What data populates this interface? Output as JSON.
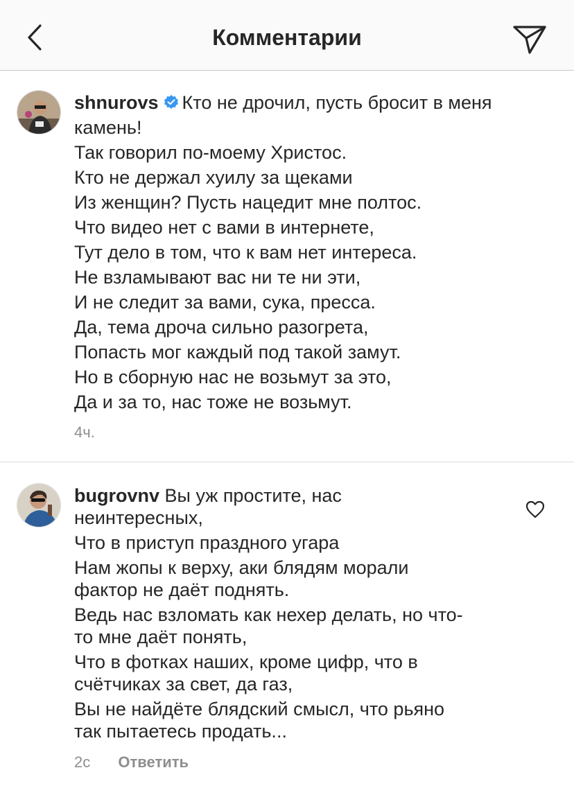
{
  "header": {
    "title": "Комментарии",
    "back_icon": "chevron-left-icon",
    "send_icon": "paper-plane-icon"
  },
  "comments": [
    {
      "username": "shnurovs",
      "verified": true,
      "first_line": "Кто не дрочил, пусть бросит в меня",
      "lines": [
        "камень!",
        "Так говорил по-моему Христос.",
        "Кто не держал хуилу за щеками",
        "Из женщин? Пусть нацедит мне полтос.",
        "Что видео нет с вами в интернете,",
        "Тут дело в том, что к вам нет интереса.",
        "Не взламывают вас ни те ни эти,",
        "И не следит за вами, сука, пресса.",
        "Да, тема дроча сильно разогрета,",
        "Попасть мог каждый под такой замут.",
        "Но в сборную нас не возьмут за это,",
        "Да и за то, нас тоже не возьмут."
      ],
      "time": "4ч."
    },
    {
      "username": "bugrovnv",
      "verified": false,
      "first_line": "Вы уж простите, нас",
      "lines": [
        "неинтересных,",
        "Что в приступ праздного угара",
        "Нам жопы к верху, аки блядям морали",
        "фактор не даёт поднять.",
        "Ведь нас взломать как нехер делать, но что-",
        "то мне даёт понять,",
        "Что в фотках наших, кроме цифр, что в",
        "счётчиках за свет, да газ,",
        "Вы не найдёте блядский смысл, что рьяно",
        "так пытаетесь продать..."
      ],
      "time": "2с",
      "reply_label": "Ответить"
    }
  ],
  "colors": {
    "text": "#262626",
    "secondary": "#8e8e8e",
    "verified": "#3897f0",
    "divider": "#dbdbdb",
    "header_bg": "#fafafa"
  }
}
